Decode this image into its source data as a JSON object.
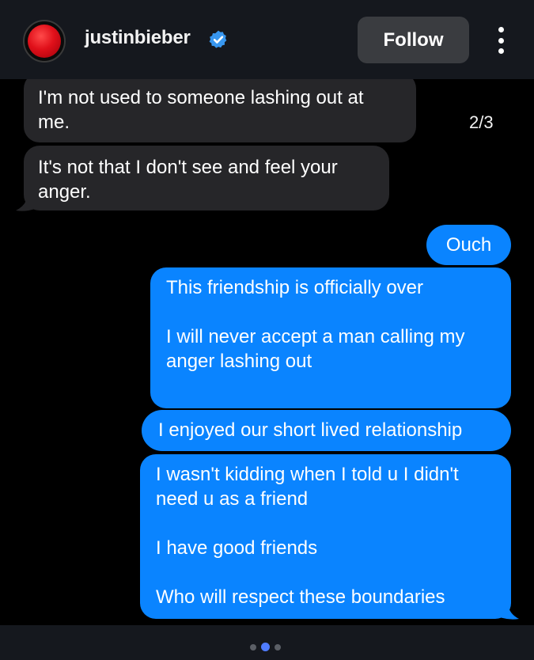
{
  "header": {
    "username": "justinbieber",
    "follow_label": "Follow",
    "verified_icon": "verified-badge-icon",
    "more_icon": "more-vertical-icon",
    "avatar_color": "#e0101a"
  },
  "post": {
    "counter": "2/3"
  },
  "messages": [
    {
      "side": "incoming",
      "text": "I'm not used to someone lashing out at\nme."
    },
    {
      "side": "incoming",
      "text": "It's not that I don't see and feel your\nanger."
    },
    {
      "side": "outgoing",
      "text": "Ouch"
    },
    {
      "side": "outgoing",
      "text": "This friendship is officially over\n\nI will never accept a man calling my\nanger lashing out"
    },
    {
      "side": "outgoing",
      "text": "I enjoyed our short lived relationship"
    },
    {
      "side": "outgoing",
      "text": "I wasn't kidding when I told u I didn't\nneed u as a friend\n\nI have good friends\n\nWho will respect these boundaries"
    }
  ],
  "carousel": {
    "total": 3,
    "active_index": 2
  },
  "colors": {
    "incoming_bubble": "#262629",
    "outgoing_bubble": "#0a84ff",
    "header_bg": "#15181e",
    "active_dot": "#4f7cff"
  }
}
